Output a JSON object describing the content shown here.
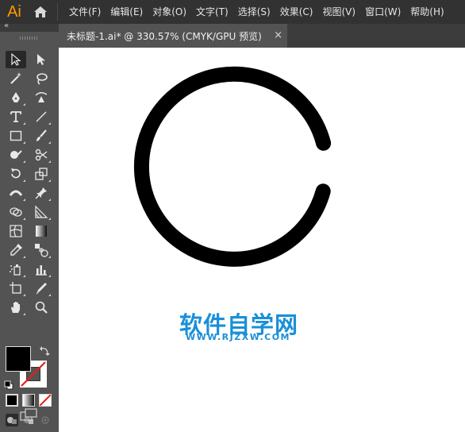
{
  "app": {
    "logo": "Ai"
  },
  "menu": {
    "items": [
      {
        "label": "文件(F)"
      },
      {
        "label": "编辑(E)"
      },
      {
        "label": "对象(O)"
      },
      {
        "label": "文字(T)"
      },
      {
        "label": "选择(S)"
      },
      {
        "label": "效果(C)"
      },
      {
        "label": "视图(V)"
      },
      {
        "label": "窗口(W)"
      },
      {
        "label": "帮助(H)"
      }
    ]
  },
  "tab": {
    "title": "未标题-1.ai* @ 330.57% (CMYK/GPU 预览)",
    "close": "×"
  },
  "toolbar": {
    "collapse": "«",
    "tools": [
      "selection-tool",
      "direct-selection-tool",
      "magic-wand-tool",
      "lasso-tool",
      "pen-tool",
      "curvature-tool",
      "type-tool",
      "line-segment-tool",
      "rectangle-tool",
      "paintbrush-tool",
      "shaper-tool",
      "scissors-tool",
      "rotate-tool",
      "scale-tool",
      "width-tool",
      "puppet-warp-tool",
      "shape-builder-tool",
      "perspective-grid-tool",
      "mesh-tool",
      "gradient-tool",
      "eyedropper-tool",
      "blend-tool",
      "symbol-sprayer-tool",
      "column-graph-tool",
      "artboard-tool",
      "slice-tool",
      "hand-tool",
      "zoom-tool"
    ],
    "fill_color": "#000000",
    "stroke_color": "#ffffff"
  },
  "canvas": {
    "stroke_color": "#000000"
  },
  "watermark": {
    "main": "软件自学网",
    "sub": "WWW.RJZXW.COM",
    "color": "#1a8fd8"
  }
}
